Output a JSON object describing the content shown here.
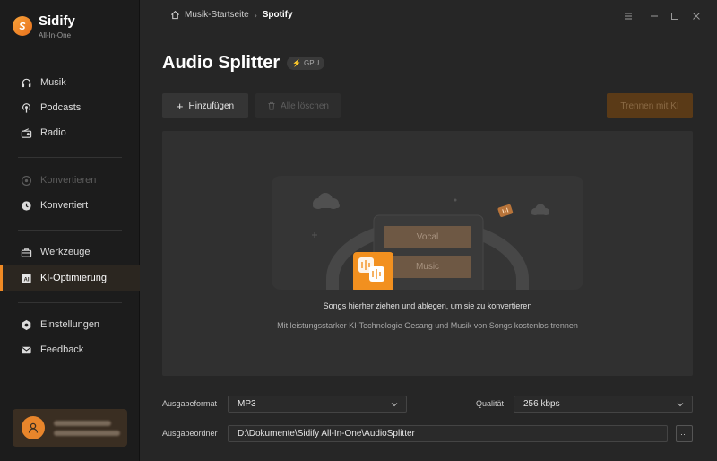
{
  "app": {
    "name": "Sidify",
    "subtitle": "All-In-One",
    "accent": "#f08a24"
  },
  "sidebar": {
    "items": [
      {
        "label": "Musik",
        "icon": "headphones-icon"
      },
      {
        "label": "Podcasts",
        "icon": "podcast-icon"
      },
      {
        "label": "Radio",
        "icon": "radio-icon"
      },
      {
        "label": "Konvertieren",
        "icon": "convert-icon"
      },
      {
        "label": "Konvertiert",
        "icon": "clock-icon"
      },
      {
        "label": "Werkzeuge",
        "icon": "toolbox-icon"
      },
      {
        "label": "KI-Optimierung",
        "icon": "ai-icon"
      },
      {
        "label": "Einstellungen",
        "icon": "settings-icon"
      },
      {
        "label": "Feedback",
        "icon": "mail-icon"
      }
    ]
  },
  "breadcrumb": {
    "home": "Musik-Startseite",
    "current": "Spotify"
  },
  "main": {
    "title": "Audio Splitter",
    "gpu_badge": "GPU",
    "add_button": "Hinzufügen",
    "clear_button": "Alle löschen",
    "split_button": "Trennen mit KI",
    "illustration": {
      "vocal_label": "Vocal",
      "music_label": "Music"
    },
    "drop_title": "Songs hierher ziehen und ablegen, um sie zu konvertieren",
    "drop_subtitle": "Mit leistungsstarker KI-Technologie Gesang und Musik von Songs kostenlos trennen"
  },
  "settings": {
    "format_label": "Ausgabeformat",
    "format_value": "MP3",
    "quality_label": "Qualität",
    "quality_value": "256 kbps",
    "folder_label": "Ausgabeordner",
    "folder_value": "D:\\Dokumente\\Sidify All-In-One\\AudioSplitter",
    "browse_button": "···"
  }
}
